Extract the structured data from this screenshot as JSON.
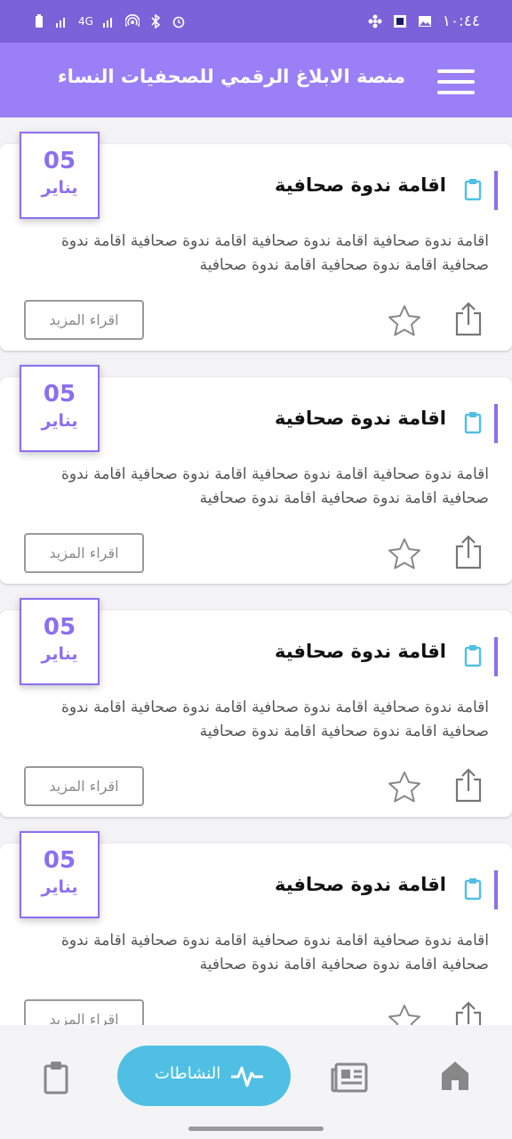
{
  "status_bar": {
    "time": "١٠:٤٤",
    "network": "4G",
    "battery_icon": "battery-icon"
  },
  "app_bar": {
    "title": "منصة الابلاغ الرقمي للصحفيات النساء",
    "menu_icon": "hamburger-menu-icon"
  },
  "cards": [
    {
      "day": "05",
      "month": "يناير",
      "title": "اقامة ندوة صحافية",
      "description": "اقامة ندوة صحافية اقامة ندوة صحافية اقامة ندوة صحافية اقامة ندوة صحافية اقامة ندوة صحافية اقامة ندوة صحافية",
      "read_more": "اقراء المزيد"
    },
    {
      "day": "05",
      "month": "يناير",
      "title": "اقامة ندوة صحافية",
      "description": "اقامة ندوة صحافية اقامة ندوة صحافية اقامة ندوة صحافية اقامة ندوة صحافية اقامة ندوة صحافية اقامة ندوة صحافية",
      "read_more": "اقراء المزيد"
    },
    {
      "day": "05",
      "month": "يناير",
      "title": "اقامة ندوة صحافية",
      "description": "اقامة ندوة صحافية اقامة ندوة صحافية اقامة ندوة صحافية اقامة ندوة صحافية اقامة ندوة صحافية اقامة ندوة صحافية",
      "read_more": "اقراء المزيد"
    },
    {
      "day": "05",
      "month": "يناير",
      "title": "اقامة ندوة صحافية",
      "description": "اقامة ندوة صحافية اقامة ندوة صحافية اقامة ندوة صحافية اقامة ندوة صحافية اقامة ندوة صحافية اقامة ندوة صحافية",
      "read_more": "اقراء المزيد"
    }
  ],
  "bottom_nav": {
    "activities_label": "النشاطات",
    "items": [
      "home-icon",
      "news-icon",
      "activity-icon",
      "clipboard-icon"
    ]
  },
  "colors": {
    "primary": "#9b7ff7",
    "status": "#7b62d8",
    "accent": "#8b6ff0",
    "active_tab": "#4fc0e3",
    "clip": "#4fc0e3"
  }
}
